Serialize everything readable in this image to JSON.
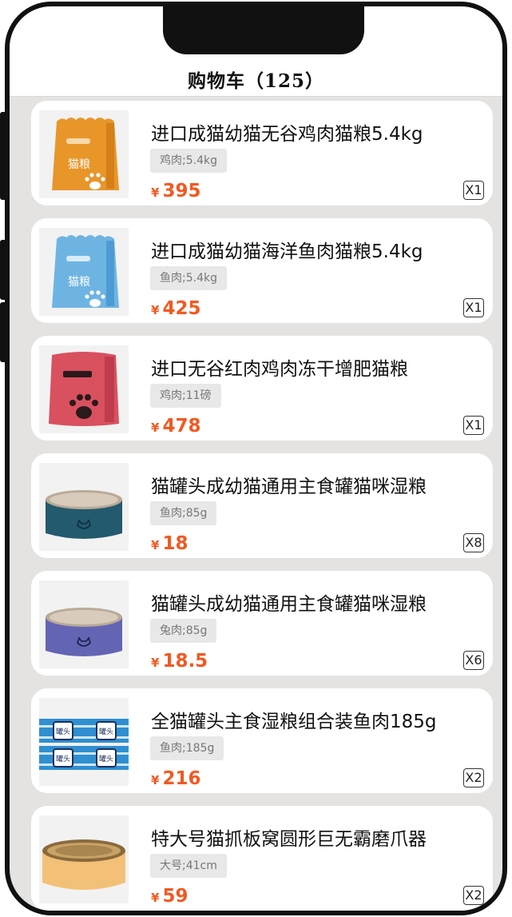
{
  "header": {
    "title": "购物车（125）"
  },
  "colors": {
    "price": "#f05a22",
    "background": "#e4e3e1"
  },
  "cart_items": [
    {
      "name": "进口成猫幼猫无谷鸡肉猫粮5.4kg",
      "spec": "鸡肉;5.4kg",
      "currency": "¥",
      "price": "395",
      "qty": "X1",
      "image": "orange-cat-food-bag",
      "bag_label": "猫粮"
    },
    {
      "name": "进口成猫幼猫海洋鱼肉猫粮5.4kg",
      "spec": "鱼肉;5.4kg",
      "currency": "¥",
      "price": "425",
      "qty": "X1",
      "image": "blue-cat-food-bag",
      "bag_label": "猫粮"
    },
    {
      "name": "进口无谷红肉鸡肉冻干增肥猫粮",
      "spec": "鸡肉;11磅",
      "currency": "¥",
      "price": "478",
      "qty": "X1",
      "image": "red-cat-food-bag"
    },
    {
      "name": "猫罐头成幼猫通用主食罐猫咪湿粮",
      "spec": "鱼肉;85g",
      "currency": "¥",
      "price": "18",
      "qty": "X8",
      "image": "teal-cat-can"
    },
    {
      "name": "猫罐头成幼猫通用主食罐猫咪湿粮",
      "spec": "兔肉;85g",
      "currency": "¥",
      "price": "18.5",
      "qty": "X6",
      "image": "purple-cat-can"
    },
    {
      "name": "全猫罐头主食湿粮组合装鱼肉185g",
      "spec": "鱼肉;185g",
      "currency": "¥",
      "price": "216",
      "qty": "X2",
      "image": "canned-food-pack",
      "can_label": "罐头"
    },
    {
      "name": "特大号猫抓板窝圆形巨无霸磨爪器",
      "spec": "大号;41cm",
      "currency": "¥",
      "price": "59",
      "qty": "X2",
      "image": "round-cat-scratcher"
    }
  ]
}
